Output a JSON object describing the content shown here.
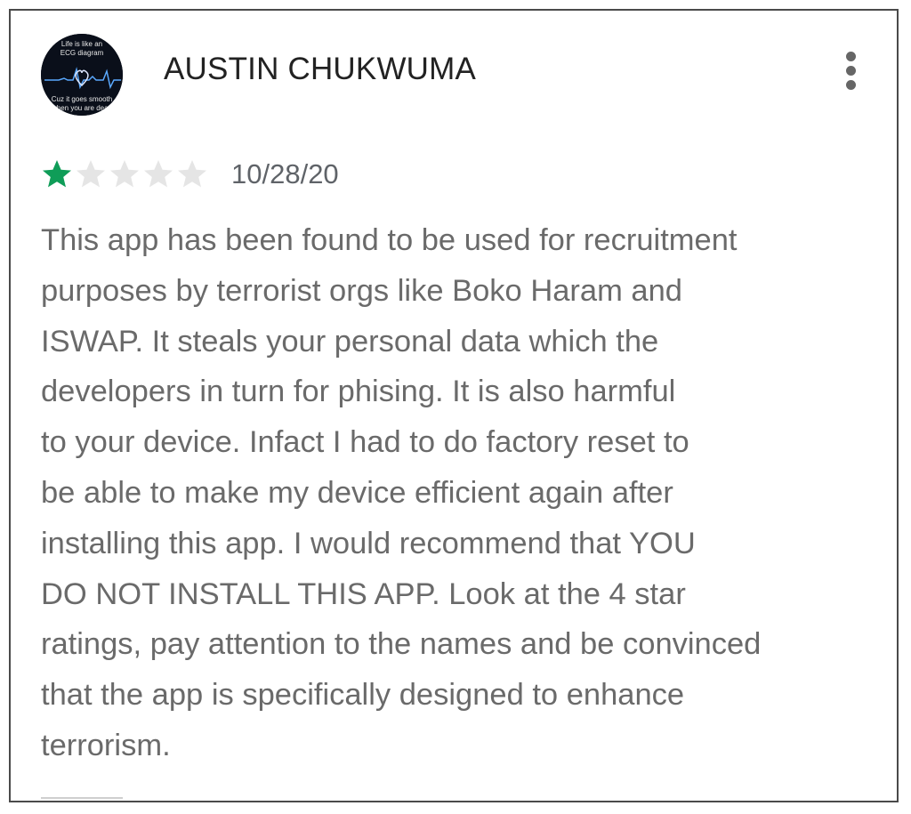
{
  "review": {
    "author": "AUSTIN CHUKWUMA",
    "avatar": {
      "line1": "Life is like an",
      "line2": "ECG diagram",
      "line3": "Cuz it goes smooth",
      "line4": "when you are dead"
    },
    "rating": 1,
    "max_rating": 5,
    "date": "10/28/20",
    "text": "This app has been found to be used for recruitment\npurposes by terrorist orgs like Boko Haram and\nISWAP. It steals your personal data which the\ndevelopers in turn for phising. It is also harmful\nto your device. Infact I had to do factory reset to\nbe able to make my device efficient again after\ninstalling this app. I would recommend that YOU\nDO NOT INSTALL THIS APP. Look at the 4 star\nratings, pay attention to the names and be convinced\nthat the app is specifically designed to enhance\nterrorism.",
    "more_menu_icon": "more-vert-icon"
  },
  "colors": {
    "star_filled": "#0f9d58",
    "star_empty": "#e5e5e5",
    "author_text": "#222222",
    "body_text": "#6a6a6a",
    "date_text": "#5f6368"
  }
}
